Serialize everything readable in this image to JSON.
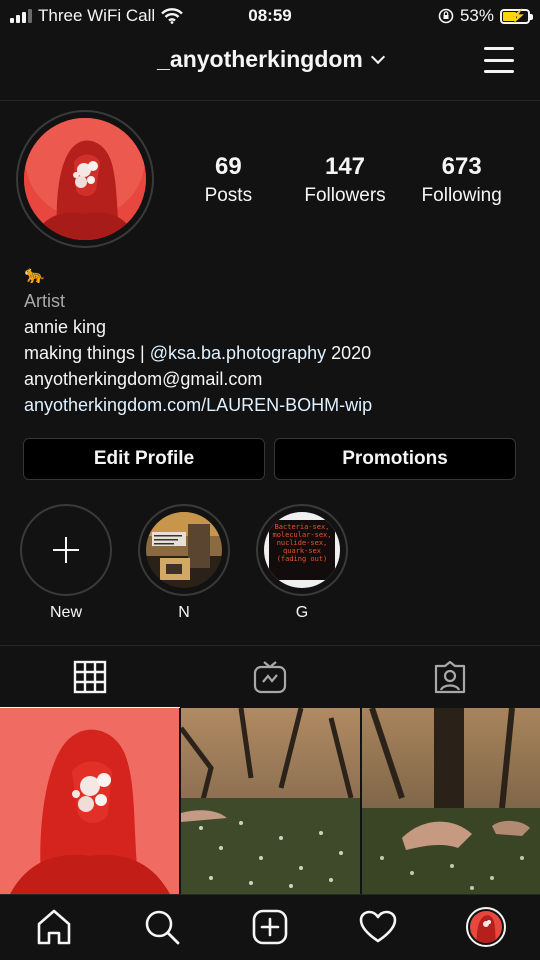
{
  "status_bar": {
    "carrier": "Three WiFi Call",
    "time": "08:59",
    "battery_percent": "53%",
    "battery_level": 0.53
  },
  "header": {
    "username": "_anyotherkingdom",
    "menu_icon": "hamburger-menu-icon"
  },
  "profile": {
    "stats": [
      {
        "value": "69",
        "label": "Posts"
      },
      {
        "value": "147",
        "label": "Followers"
      },
      {
        "value": "673",
        "label": "Following"
      }
    ],
    "bio": {
      "emoji": "🐆",
      "category": "Artist",
      "name": "annie king",
      "line_prefix": "making things | ",
      "mention": "@ksa.ba.photography",
      "line_suffix": " 2020",
      "email": "anyotherkingdom@gmail.com",
      "website": "anyotherkingdom.com/LAUREN-BOHM-wip"
    }
  },
  "buttons": {
    "edit_profile": "Edit Profile",
    "promotions": "Promotions"
  },
  "highlights": [
    {
      "label": "New"
    },
    {
      "label": "N"
    },
    {
      "label": "G",
      "text": "Bacteria-sex, molecular-sex, nuclide-sex, quark-sex (fading out)"
    }
  ],
  "tabs": [
    "grid-icon",
    "igtv-icon",
    "tagged-icon"
  ],
  "bottom_nav": [
    "home-icon",
    "search-icon",
    "new-post-icon",
    "activity-heart-icon",
    "profile-avatar"
  ],
  "colors": {
    "background": "#121212",
    "avatar_red": "#e03a36",
    "link": "#e0f1ff",
    "secondary_text": "#a8a8a8",
    "battery_charging": "#f5d90a"
  }
}
